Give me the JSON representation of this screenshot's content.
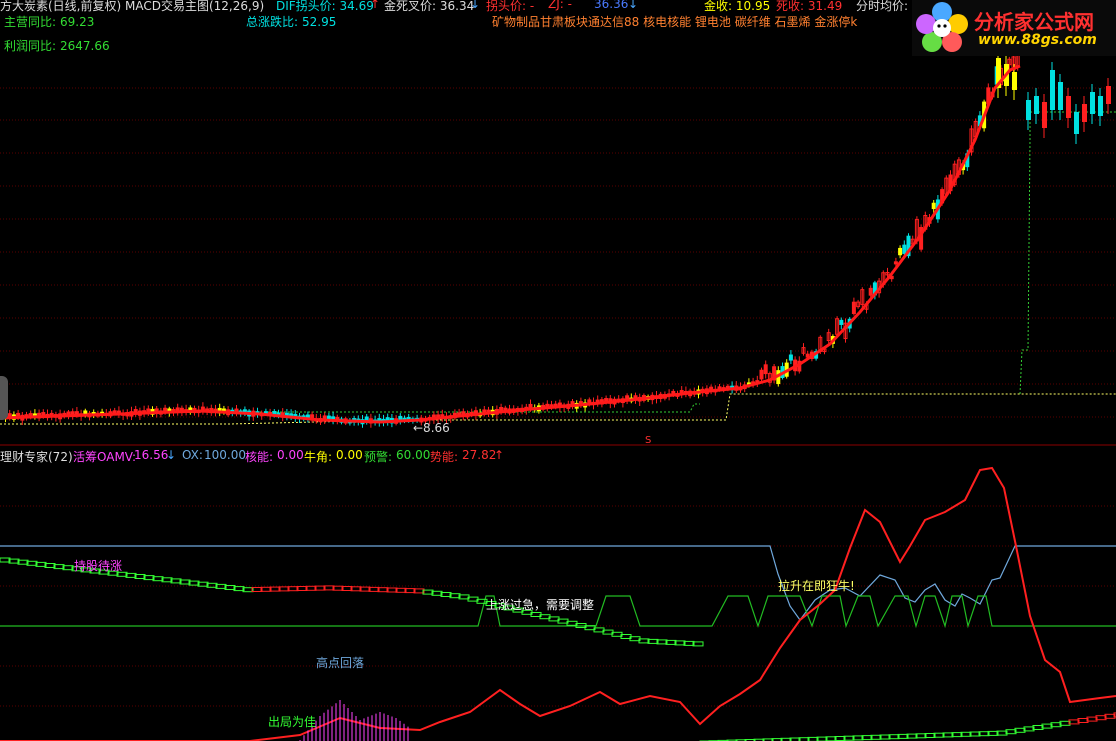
{
  "header": {
    "title": "方大炭素(日线,前复权) MACD交易主图(12,26,9)",
    "dif": "DIF拐头价: 34.69",
    "dif_arrow": "↑",
    "golden": "金死叉价: 36.34",
    "golden_arrow": "↓",
    "turn": "拐头价: -",
    "zj": "ZJ: -",
    "val": "36.36",
    "val_arrow": "↓",
    "gold_close": "金收: 10.95",
    "dead_close": "死收: 31.49",
    "avg": "分时均价:"
  },
  "info": {
    "main_yoy_label": "主营同比:",
    "main_yoy": "69.23",
    "total_chg_label": "总涨跌比:",
    "total_chg": "52.95",
    "profit_yoy_label": "利润同比:",
    "profit_yoy": "2647.66",
    "sectors": "矿物制品甘肃板块通达信88 核电核能 锂电池 碳纤维 石墨烯 金涨停k"
  },
  "price_marks": {
    "low_label": "←8.66",
    "s_mark": "S"
  },
  "indicator": {
    "name": "理财专家(72)",
    "oamv_label": "活筹OAMV:",
    "oamv": "16.56",
    "oamv_arrow": "↓",
    "ox_label": "OX:",
    "ox": "100.00",
    "core_label": "核能:",
    "core": "0.00",
    "bull_label": "牛角:",
    "bull": "0.00",
    "warn_label": "预警:",
    "warn": "60.00",
    "trend_label": "势能:",
    "trend": "27.82",
    "trend_arrow": "↑"
  },
  "annotations": {
    "hold": "持股待涨",
    "overheat": "上涨过急，需要调整",
    "bull_run": "拉升在即狂牛!",
    "pullback": "高点回落",
    "exit": "出局为佳"
  },
  "logo": {
    "title": "分析家公式网",
    "url": "www.88gs.com"
  },
  "colors": {
    "up": "#ff2020",
    "down": "#00e0e0",
    "yellow": "#ffff00",
    "green_line": "#00cc00",
    "blue_line": "#6fa8dc",
    "magenta": "#ff44ff",
    "bright_green": "#33ff33"
  },
  "chart_data": {
    "type": "line",
    "price_series": {
      "name": "",
      "x_index": [
        0,
        10,
        20,
        30,
        40,
        50,
        60,
        70,
        80,
        90,
        100,
        110,
        120,
        130,
        140,
        150,
        160,
        170,
        180,
        190,
        200,
        210,
        220,
        230,
        240
      ],
      "values": [
        8.9,
        9.3,
        9.6,
        9.2,
        8.9,
        8.7,
        8.66,
        9.2,
        10.0,
        10.6,
        11.0,
        11.3,
        11.6,
        12.5,
        15,
        18,
        22,
        26,
        29,
        32,
        34,
        36,
        35,
        34,
        35
      ]
    },
    "ox_series": {
      "name": "OX",
      "values": [
        100,
        100,
        100,
        100,
        100,
        100,
        100,
        100,
        100,
        100,
        100,
        100,
        100,
        100,
        100,
        100,
        100,
        60,
        60,
        70,
        80,
        75,
        65,
        70,
        100
      ]
    },
    "trend_series": {
      "name": "势能",
      "values": [
        2,
        4,
        8,
        12,
        10,
        6,
        8,
        18,
        10,
        6,
        4,
        5,
        4,
        8,
        30,
        60,
        80,
        85,
        75,
        70,
        80,
        95,
        60,
        20,
        27.82
      ]
    },
    "warn_level": 60
  }
}
